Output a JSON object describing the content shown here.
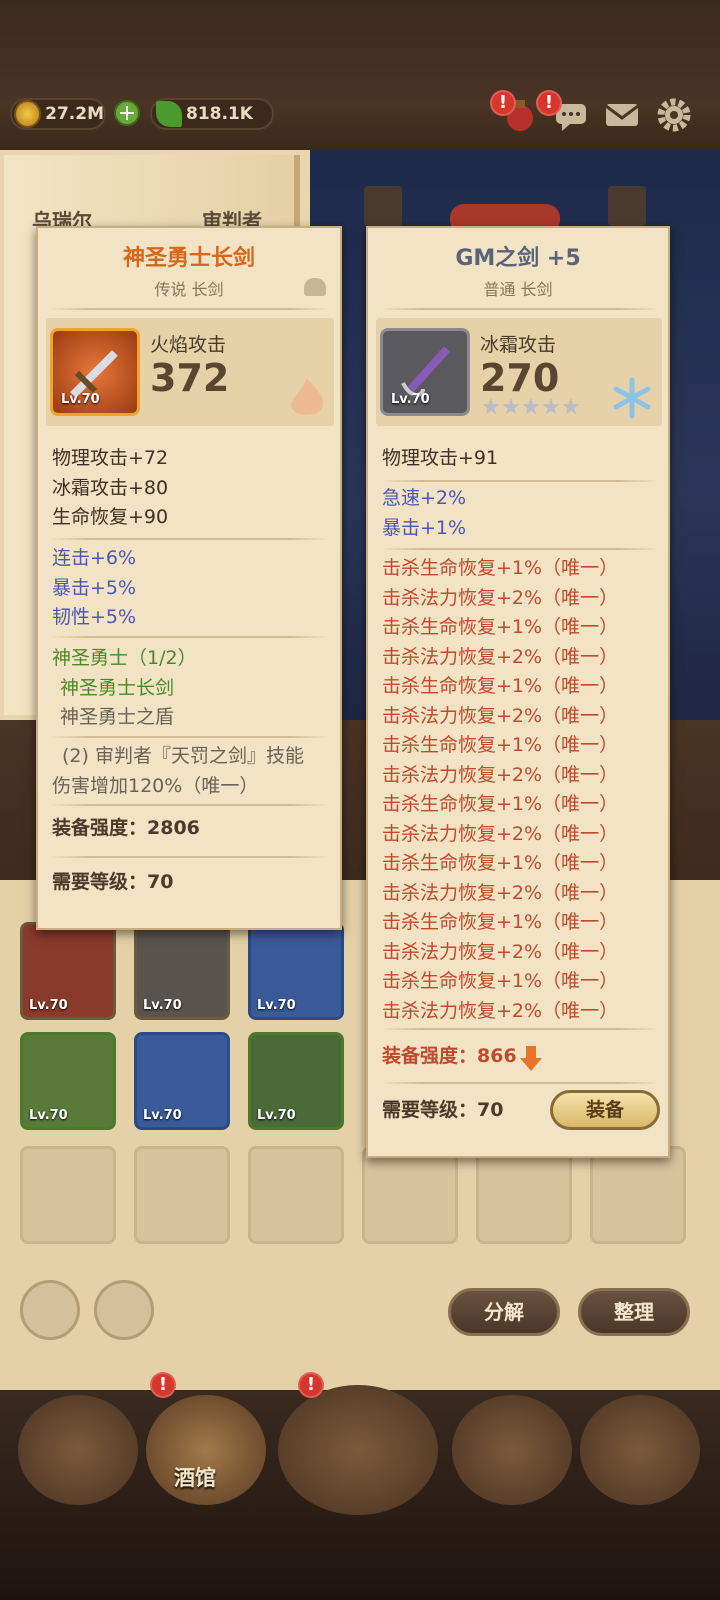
{
  "topbar": {
    "gold": "27.2M",
    "gems": "818.1K",
    "alert_mark": "!"
  },
  "background": {
    "left_name_partial": "乌瑞尔",
    "left_class_partial": "审判者"
  },
  "left_card": {
    "title": "神圣勇士长剑",
    "subtitle": "传说 长剑",
    "icon_level": "Lv.70",
    "main_stat_name": "火焰攻击",
    "main_stat_value": "372",
    "base_stats": [
      "物理攻击+72",
      "冰霜攻击+80",
      "生命恢复+90"
    ],
    "bonus_stats": [
      "连击+6%",
      "暴击+5%",
      "韧性+5%"
    ],
    "set_name": "神圣勇士（1/2）",
    "set_items": [
      "神圣勇士长剑",
      "神圣勇士之盾"
    ],
    "set_bonus_line1": "(2) 审判者『天罚之剑』技能",
    "set_bonus_line2": "伤害增加120%（唯一）",
    "power_label": "装备强度：",
    "power_value": "2806",
    "req_label": "需要等级：",
    "req_value": "70"
  },
  "right_card": {
    "title": "GM之剑 +5",
    "subtitle": "普通 长剑",
    "icon_level": "Lv.70",
    "main_stat_name": "冰霜攻击",
    "main_stat_value": "270",
    "star_count": 5,
    "base_stats": [
      "物理攻击+91"
    ],
    "bonus_stats": [
      "急速+2%",
      "暴击+1%"
    ],
    "kill_stats": [
      "击杀生命恢复+1%（唯一）",
      "击杀法力恢复+2%（唯一）",
      "击杀生命恢复+1%（唯一）",
      "击杀法力恢复+2%（唯一）",
      "击杀生命恢复+1%（唯一）",
      "击杀法力恢复+2%（唯一）",
      "击杀生命恢复+1%（唯一）",
      "击杀法力恢复+2%（唯一）",
      "击杀生命恢复+1%（唯一）",
      "击杀法力恢复+2%（唯一）",
      "击杀生命恢复+1%（唯一）",
      "击杀法力恢复+2%（唯一）",
      "击杀生命恢复+1%（唯一）",
      "击杀法力恢复+2%（唯一）",
      "击杀生命恢复+1%（唯一）",
      "击杀法力恢复+2%（唯一）"
    ],
    "power_label": "装备强度：",
    "power_value": "866",
    "req_label": "需要等级：",
    "req_value": "70",
    "equip_label": "装备"
  },
  "inventory": {
    "slot_levels": [
      "Lv.70",
      "Lv.70",
      "Lv.70",
      "Lv.70",
      "Lv.70",
      "Lv.70"
    ],
    "decompose_label": "分解",
    "sort_label": "整理"
  },
  "bottom_nav": {
    "tavern_label": "酒馆"
  },
  "colors": {
    "legendary_title": "#d8661c",
    "common_title": "#5a6478",
    "stat_blue": "#4a56b8",
    "stat_green": "#4a8a24",
    "stat_red": "#c04a2e"
  }
}
